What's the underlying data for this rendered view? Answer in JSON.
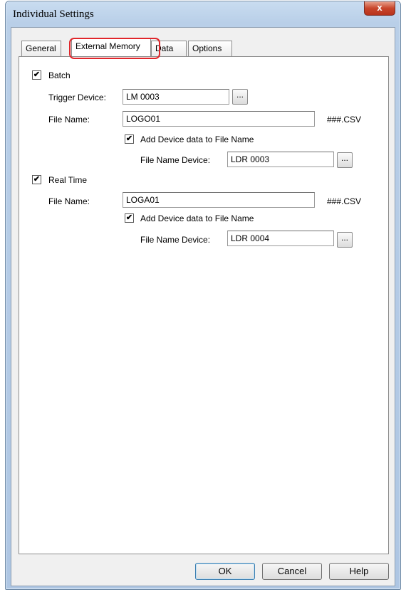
{
  "window": {
    "title": "Individual Settings",
    "close_icon": "close-icon"
  },
  "tabs": [
    {
      "label": "General"
    },
    {
      "label": "External Memory",
      "active": true
    },
    {
      "label": "Data"
    },
    {
      "label": "Options"
    }
  ],
  "batch": {
    "checkbox_label": "Batch",
    "checked": true,
    "trigger_device_label": "Trigger Device:",
    "trigger_device_value": "LM 0003",
    "file_name_label": "File Name:",
    "file_name_value": "LOGO01",
    "file_suffix": "###.CSV",
    "add_device_label": "Add Device data to File Name",
    "add_device_checked": true,
    "file_name_device_label": "File Name Device:",
    "file_name_device_value": "LDR 0003"
  },
  "real_time": {
    "checkbox_label": "Real Time",
    "checked": true,
    "file_name_label": "File Name:",
    "file_name_value": "LOGA01",
    "file_suffix": "###.CSV",
    "add_device_label": "Add Device data to File Name",
    "add_device_checked": true,
    "file_name_device_label": "File Name Device:",
    "file_name_device_value": "LDR 0004"
  },
  "browse_label": "...",
  "check_mark": "✔",
  "buttons": {
    "ok": "OK",
    "cancel": "Cancel",
    "help": "Help"
  },
  "colors": {
    "highlight": "#e0262b",
    "close_button": "#c9462c"
  }
}
